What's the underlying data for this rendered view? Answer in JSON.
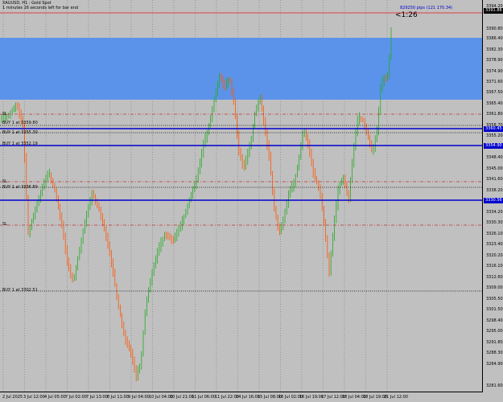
{
  "header": {
    "symbol_line": "XAUUSD, H1 : Gold Spot",
    "timer_line": "1 minutes 16 seconds left for bar end"
  },
  "countdown": "<1:26",
  "pips_label": "829250 pips (121 170.34)",
  "price_axis": {
    "ticks": [
      "3394.20",
      "3390.80",
      "3386.40",
      "3382.30",
      "3378.90",
      "3374.90",
      "3371.60",
      "3367.50",
      "3365.40",
      "3361.80",
      "3358.70",
      "3355.20",
      "3352.30",
      "3348.40",
      "3345.00",
      "3341.60",
      "3338.20",
      "3334.20",
      "3330.30",
      "3326.10",
      "3323.40",
      "3320.20",
      "3316.10",
      "3312.60",
      "3309.00",
      "3305.50",
      "3301.50",
      "3298.40",
      "3295.00",
      "3291.80",
      "3288.30",
      "3284.90",
      "3281.60"
    ],
    "current_label": "3391.86",
    "line_labels": [
      "3360.45",
      "3354.90",
      "3330.56"
    ]
  },
  "time_axis": {
    "labels": [
      "2 Jul 2025",
      "3 Jul 12:00",
      "4 Jul 05:00",
      "7 Jul 02:00",
      "7 Jul 13:00",
      "8 Jul 11:00",
      "9 Jul 04:00",
      "10 Jul 04:00",
      "10 Jul 21:00",
      "11 Jul 06:00",
      "11 Jul 22:00",
      "14 Jul 16:00",
      "15 Jul 08:00",
      "16 Jul 02:00",
      "16 Jul 19:00",
      "17 Jul 12:00",
      "18 Jul 04:00",
      "18 Jul 19:00",
      "21 Jul 12:00"
    ]
  },
  "overlay_labels": {
    "buy_lines": [
      "BUY 1 at 3359.80",
      "BUY 1 at 3355.30",
      "BUY 1 at 3352.19",
      "BUY 1 at 3336.80",
      "BUY 1 at 3302.51"
    ],
    "sl_markers": [
      "SL",
      "SL",
      "SL"
    ]
  },
  "colors": {
    "background": "#c0c0c0",
    "zone": "#5b93ea",
    "bull": "#22aa22",
    "bear": "#ff5500",
    "blue_line": "#0000cc",
    "red_line": "#e04040"
  }
}
